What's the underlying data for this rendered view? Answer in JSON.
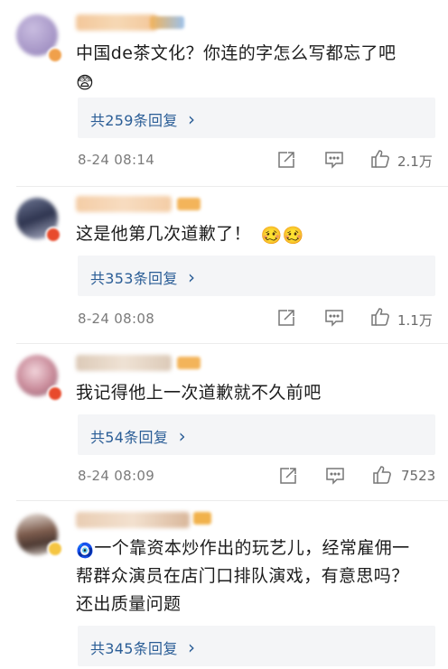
{
  "comments": [
    {
      "text": "中国de茶文化？你连的字怎么写都忘了吧",
      "emoji_line": "😨",
      "reply_label": "共259条回复",
      "reply_arrow": "›",
      "time": "8-24 08:14",
      "likes": "2.1万",
      "avatar_color": "#b4a6cf",
      "avatar_badge_color": "#f0a04b"
    },
    {
      "text": "这是他第几次道歉了！",
      "emoji_inline": "🥴🥴",
      "reply_label": "共353条回复",
      "reply_arrow": "›",
      "time": "8-24 08:08",
      "likes": "1.1万",
      "avatar_color": "#8b90a8",
      "avatar_badge_color": "#e84a2c"
    },
    {
      "text": "我记得他上一次道歉就不久前吧",
      "reply_label": "共54条回复",
      "reply_arrow": "›",
      "time": "8-24 08:09",
      "likes": "7523",
      "avatar_color": "#d7a4b0",
      "avatar_badge_color": "#e84a2c"
    },
    {
      "text_line1": "一个靠资本炒作出的玩艺儿，经常雇佣一",
      "text_line2": "帮群众演员在店门口排队演戏，有意思吗？",
      "text_line3": "还出质量问题",
      "leading_icon": "🧿",
      "reply_label": "共345条回复",
      "reply_arrow": "›",
      "avatar_color": "#9a7e6d",
      "avatar_badge_color": "#f5c542"
    }
  ],
  "icons": {
    "share": "share-icon",
    "comment": "comment-icon",
    "like": "like-icon"
  },
  "colors": {
    "link_blue": "#2a5d96",
    "reply_bg": "#f4f5f7",
    "meta_gray": "#7b7b7b"
  }
}
